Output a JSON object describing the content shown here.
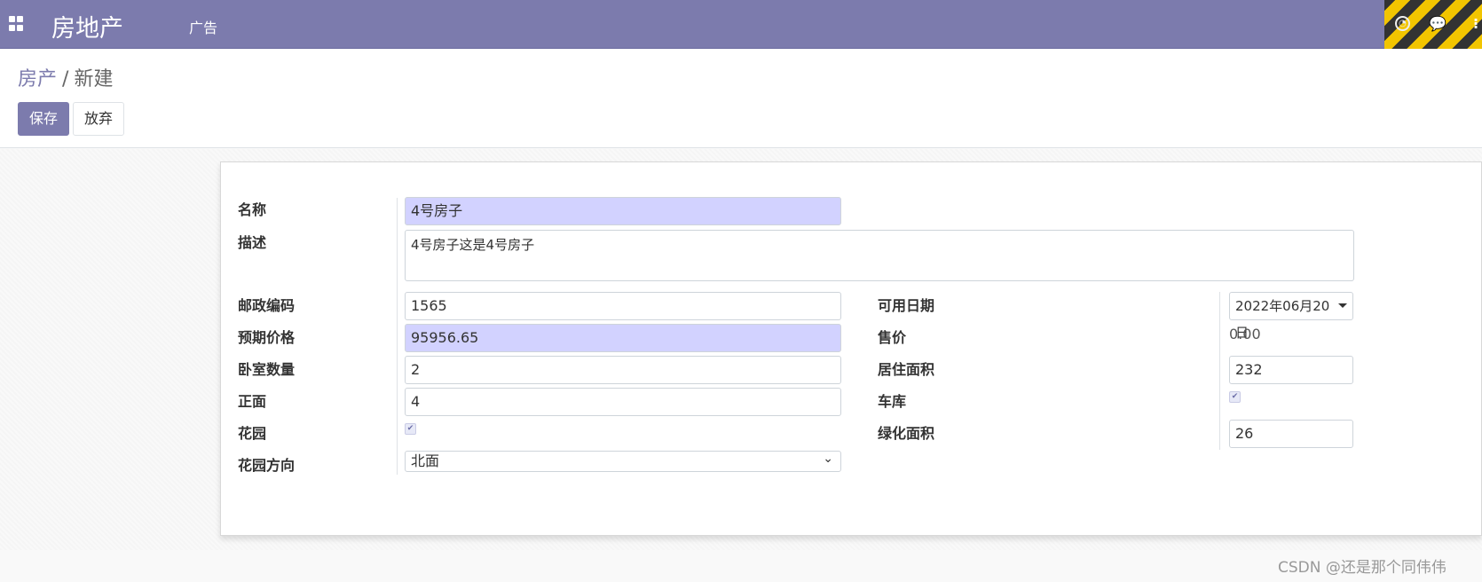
{
  "navbar": {
    "app_title": "房地产",
    "menu_item": "广告",
    "clock_icon": "clock-icon",
    "chat_icon": "chat-icon",
    "more_icon": "more-icon",
    "clock_glyph": "◔",
    "chat_glyph": "💬",
    "more_glyph": "⁝"
  },
  "breadcrumb": {
    "parent": "房产",
    "separator": "/",
    "current": "新建"
  },
  "buttons": {
    "save": "保存",
    "discard": "放弃"
  },
  "form": {
    "name": {
      "label": "名称",
      "value": "4号房子",
      "required": true
    },
    "description": {
      "label": "描述",
      "value": "4号房子这是4号房子"
    },
    "postcode": {
      "label": "邮政编码",
      "value": "1565"
    },
    "expected_price": {
      "label": "预期价格",
      "value": "95956.65",
      "required": true
    },
    "bedrooms": {
      "label": "卧室数量",
      "value": "2"
    },
    "facades": {
      "label": "正面",
      "value": "4"
    },
    "garden": {
      "label": "花园",
      "checked": true,
      "glyph": "✔"
    },
    "garden_orientation": {
      "label": "花园方向",
      "value": "北面",
      "arrow": "⌄"
    },
    "date_availability": {
      "label": "可用日期",
      "value": "2022年06月20日"
    },
    "selling_price": {
      "label": "售价",
      "value": "0.00"
    },
    "living_area": {
      "label": "居住面积",
      "value": "232"
    },
    "garage": {
      "label": "车库",
      "checked": true,
      "glyph": "✔"
    },
    "garden_area": {
      "label": "绿化面积",
      "value": "26"
    }
  },
  "watermark": "CSDN @还是那个同伟伟"
}
